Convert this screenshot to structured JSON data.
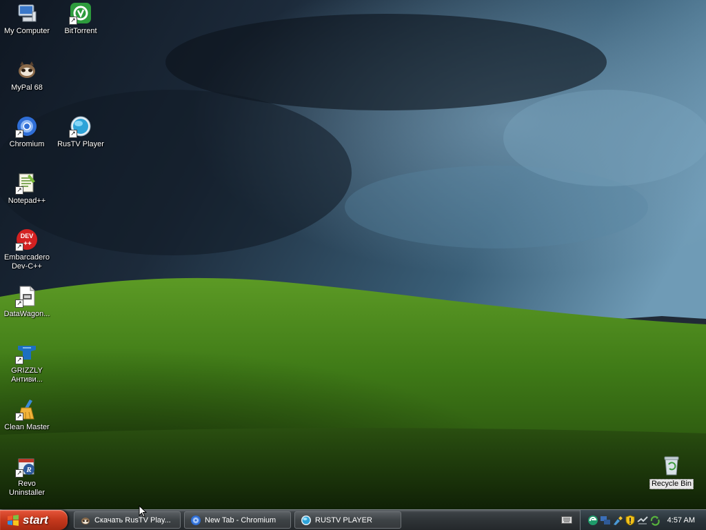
{
  "desktop": {
    "icons": [
      {
        "label": "My Computer",
        "icon": "my-computer-icon"
      },
      {
        "label": "BitTorrent",
        "icon": "bittorrent-icon"
      },
      {
        "label": "MyPal 68",
        "icon": "mypal-icon"
      },
      {
        "label": "Chromium",
        "icon": "chromium-icon"
      },
      {
        "label": "RusTV Player",
        "icon": "rustv-icon"
      },
      {
        "label": "Notepad++",
        "icon": "notepadpp-icon"
      },
      {
        "label": "Embarcadero\nDev-C++",
        "icon": "devcpp-icon"
      },
      {
        "label": "DataWagon...",
        "icon": "datawagon-icon"
      },
      {
        "label": "GRIZZLY\nАнтиви...",
        "icon": "grizzly-icon"
      },
      {
        "label": "Clean Master",
        "icon": "clean-master-icon"
      },
      {
        "label": "Revo\nUninstaller",
        "icon": "revo-uninstaller-icon"
      },
      {
        "label": "Recycle Bin",
        "icon": "recycle-bin-icon"
      }
    ]
  },
  "taskbar": {
    "start_label": "start",
    "buttons": [
      {
        "label": "Скачать RusTV Play...",
        "icon": "mypal-icon"
      },
      {
        "label": "New Tab - Chromium",
        "icon": "chromium-icon"
      },
      {
        "label": "RUSTV PLAYER",
        "icon": "rustv-icon"
      }
    ],
    "tray_icons": [
      "edge-icon",
      "network-icon",
      "paint-icon",
      "shield-icon",
      "connection-icon",
      "recycle-tray-icon"
    ],
    "clock": "4:57 AM"
  },
  "colors": {
    "taskbar": "#2f3437",
    "start_button": "#c73a1e",
    "sky": "#1b2a3d",
    "hill": "#4f8a1e"
  }
}
